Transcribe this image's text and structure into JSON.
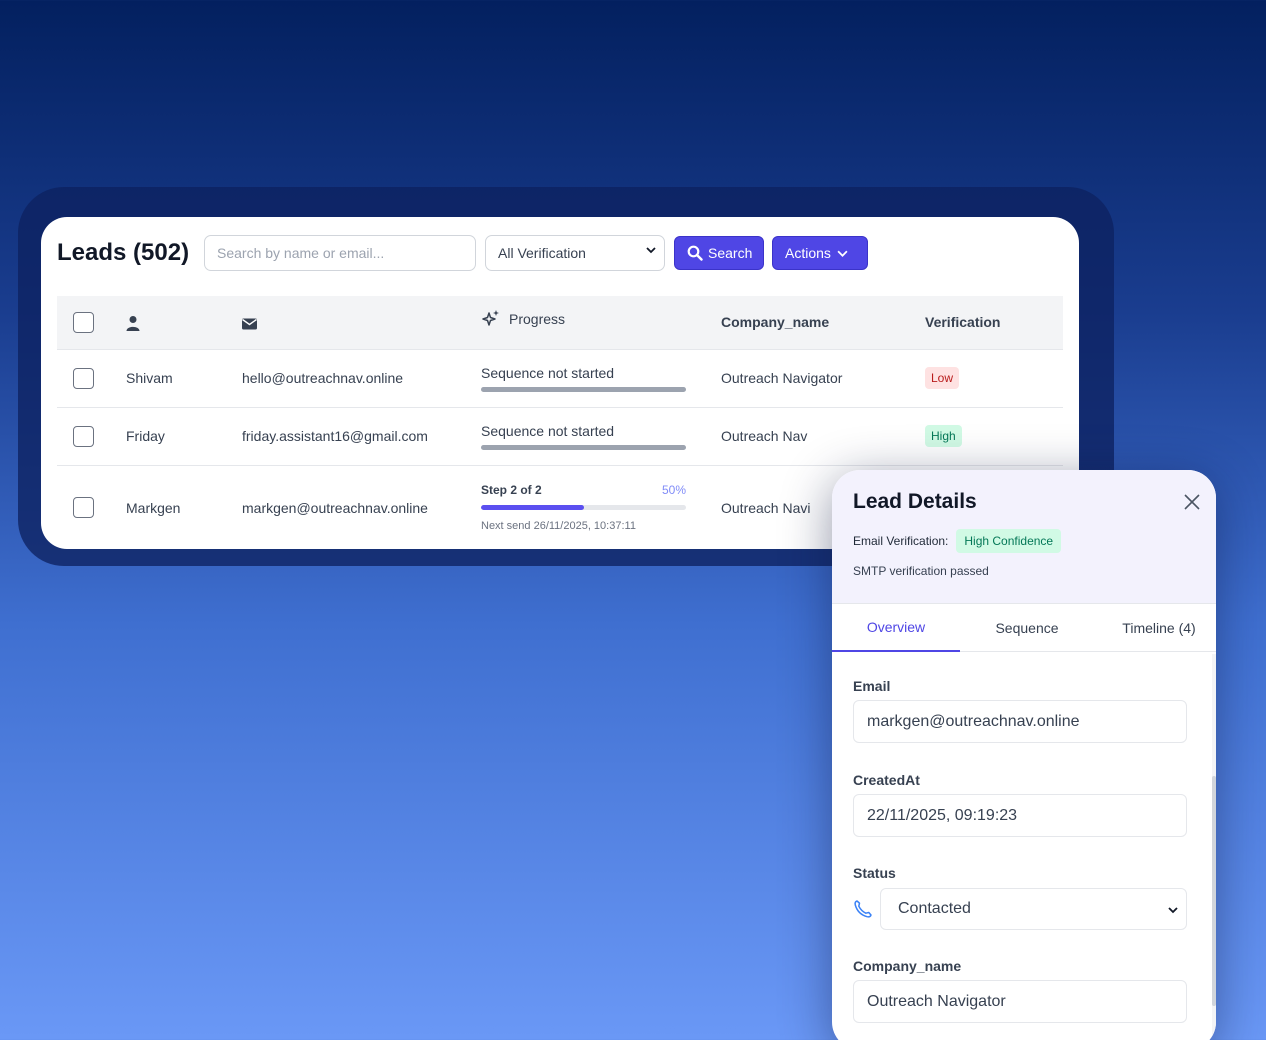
{
  "leads": {
    "title": "Leads (502)",
    "search_placeholder": "Search by name or email...",
    "verification_filter": "All Verification",
    "search_button": "Search",
    "actions_button": "Actions",
    "columns": {
      "progress": "Progress",
      "company": "Company_name",
      "verification": "Verification"
    },
    "rows": [
      {
        "name": "Shivam",
        "email": "hello@outreachnav.online",
        "progress": "Sequence not started",
        "company": "Outreach Navigator",
        "verification": "Low"
      },
      {
        "name": "Friday",
        "email": "friday.assistant16@gmail.com",
        "progress": "Sequence not started",
        "company": "Outreach Nav",
        "verification": "High"
      },
      {
        "name": "Markgen",
        "email": "markgen@outreachnav.online",
        "step": "Step 2 of 2",
        "percent": "50%",
        "percent_value": 0.5,
        "next_send": "Next send 26/11/2025, 10:37:11",
        "company": "Outreach Navi"
      }
    ]
  },
  "panel": {
    "title": "Lead Details",
    "email_verification_label": "Email Verification:",
    "email_verification_value": "High Confidence",
    "smtp_text": "SMTP verification passed",
    "tabs": [
      "Overview",
      "Sequence",
      "Timeline (4)"
    ],
    "fields": {
      "email_label": "Email",
      "email_value": "markgen@outreachnav.online",
      "created_label": "CreatedAt",
      "created_value": "22/11/2025, 09:19:23",
      "status_label": "Status",
      "status_value": "Contacted",
      "company_label": "Company_name",
      "company_value": "Outreach Navigator"
    }
  },
  "colors": {
    "accent": "#4f46e5",
    "low_badge": "#fee2e2",
    "high_badge": "#d1fae5"
  },
  "icons": [
    "user-icon",
    "mail-icon",
    "sparkles-icon",
    "search-icon",
    "chevron-down-icon",
    "close-icon",
    "phone-icon"
  ]
}
